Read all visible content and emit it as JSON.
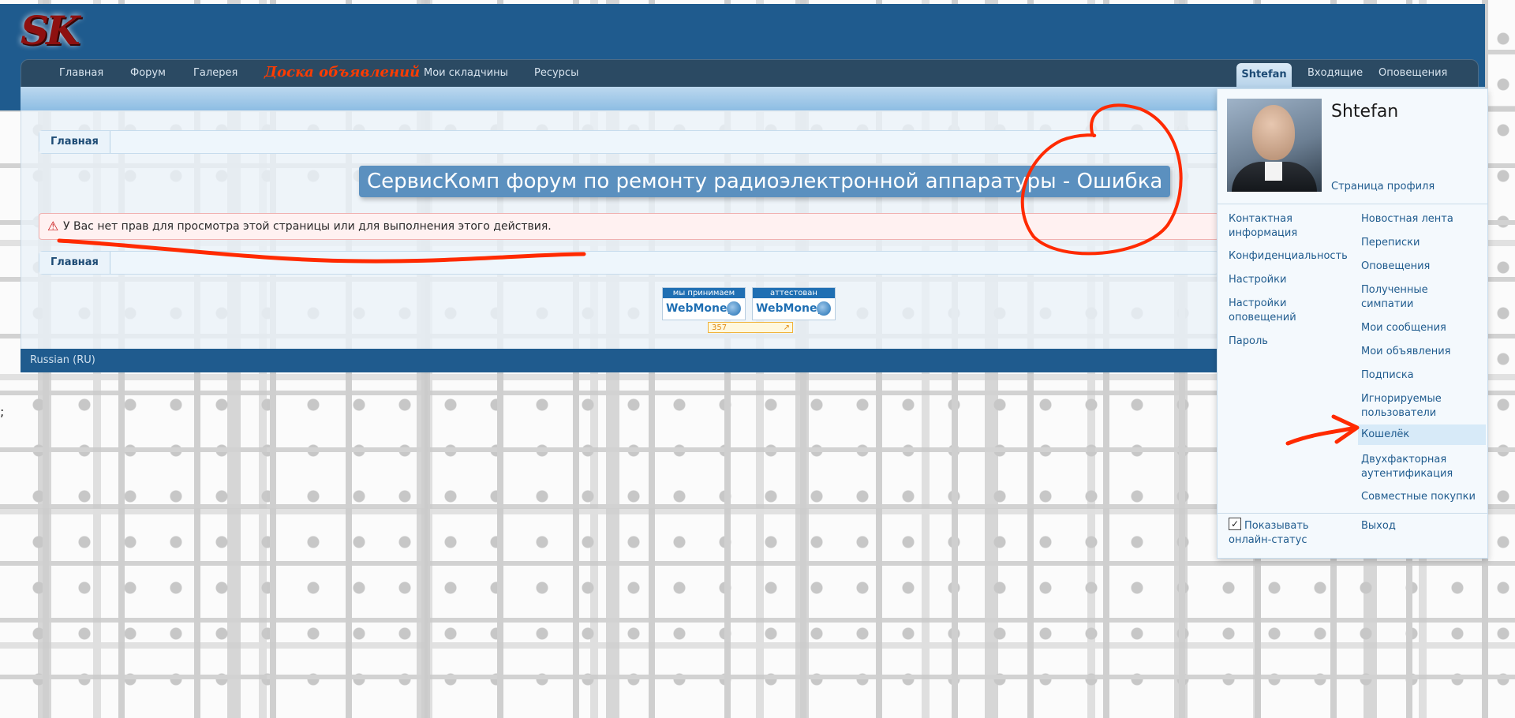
{
  "logo": {
    "text": "SK"
  },
  "nav": {
    "items": [
      "Главная",
      "Форум",
      "Галерея"
    ],
    "highlight": "Доска объявлений",
    "items2": [
      "Мои складчины",
      "Ресурсы"
    ],
    "user_tab": "Shtefan",
    "inbox": "Входящие",
    "alerts": "Оповещения"
  },
  "breadcrumb": {
    "top": "Главная",
    "bottom": "Главная"
  },
  "page": {
    "title": "СервисКомп форум по ремонту радиоэлектронной аппаратуры - Ошибка",
    "error": "У Вас нет прав для просмотра этой страницы или для выполнения этого действия."
  },
  "badges": {
    "wm1_top": "мы принимаем",
    "wm1_logo": "WebMoney",
    "wm2_top": "аттестован",
    "wm2_logo": "WebMoney",
    "counter": "357"
  },
  "footer": {
    "language": "Russian (RU)"
  },
  "stray": {
    "semicolon": ";"
  },
  "user_panel": {
    "username": "Shtefan",
    "profile_link": "Страница профиля",
    "left_links": [
      "Контактная информация",
      "Конфиденциальность",
      "Настройки",
      "Настройки оповещений",
      "Пароль"
    ],
    "right_links": [
      "Новостная лента",
      "Переписки",
      "Оповещения",
      "Полученные симпатии",
      "Мои сообщения",
      "Мои объявления",
      "Подписка",
      "Игнорируемые пользователи",
      "Кошелёк",
      "Двухфакторная аутентификация",
      "Совместные покупки"
    ],
    "online_status": "Показывать онлайн-статус",
    "logout": "Выход",
    "checked": true
  },
  "colors": {
    "header": "#1f5b8e",
    "nav": "#2b4a63",
    "accent": "#ff3c00",
    "annotation": "#ff2a00"
  }
}
